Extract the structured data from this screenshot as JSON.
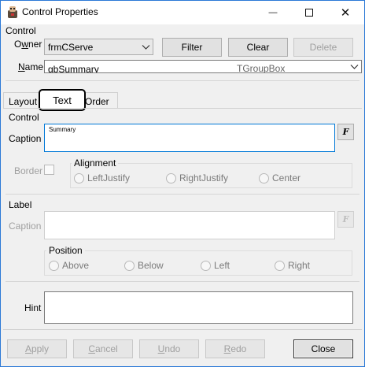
{
  "window": {
    "title": "Control Properties",
    "minimize_glyph": "—",
    "maximize_glyph": "☐",
    "close_glyph": "✕"
  },
  "control_group": {
    "label": "Control",
    "owner_label_pre": "O",
    "owner_label_u": "w",
    "owner_label_post": "ner",
    "owner_value": "frmCServe",
    "filter_label": "Filter",
    "clear_label": "Clear",
    "delete_label": "Delete",
    "name_label_u": "N",
    "name_label_post": "ame",
    "name_value": "gbSummary",
    "name_type": "TGroupBox"
  },
  "tabs": {
    "layout": "Layout",
    "text": "Text",
    "order": "Order"
  },
  "text_tab": {
    "control_label": "Control",
    "caption_label": "Caption",
    "caption_value": "Summary",
    "caption_font_button": "F",
    "border_label": "Border",
    "alignment_label": "Alignment",
    "align_left": "LeftJustify",
    "align_right": "RightJustify",
    "align_center": "Center",
    "label_group": "Label",
    "label_caption_label": "Caption",
    "label_font_button": "F",
    "position_label": "Position",
    "pos_above": "Above",
    "pos_below": "Below",
    "pos_left": "Left",
    "pos_right": "Right",
    "hint_label": "Hint"
  },
  "footer": {
    "apply_u": "A",
    "apply_rest": "pply",
    "cancel_u": "C",
    "cancel_rest": "ancel",
    "undo_u": "U",
    "undo_rest": "ndo",
    "redo_u": "R",
    "redo_rest": "edo",
    "close": "Close"
  },
  "colors": {
    "window_border": "#2b79d7",
    "focus_border": "#0078d7",
    "dialog_bg": "#f0f0f0",
    "disabled_text": "#a0a0a0"
  }
}
